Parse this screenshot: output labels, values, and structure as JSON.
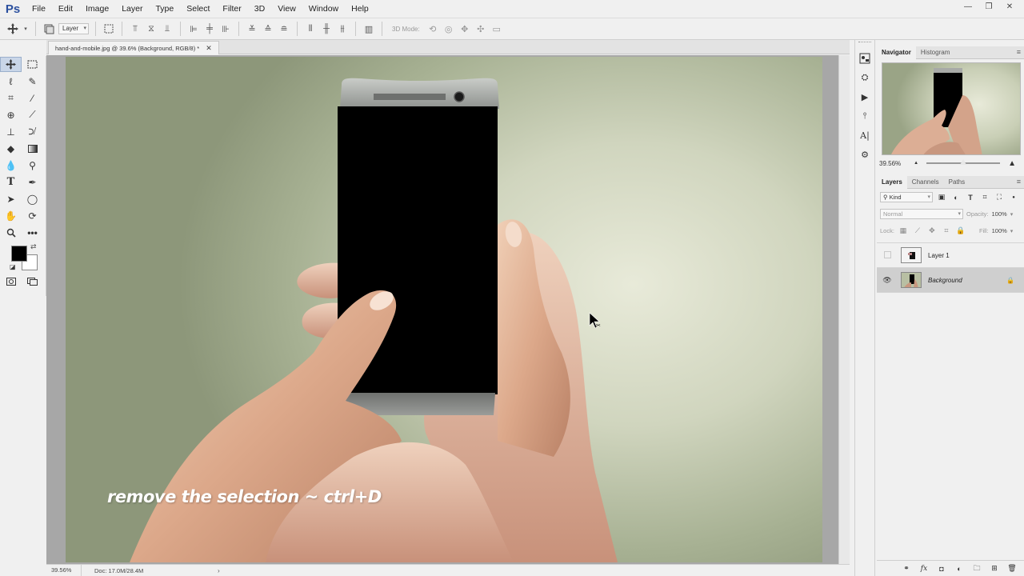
{
  "app": {
    "logo": "Ps"
  },
  "menu": [
    "File",
    "Edit",
    "Image",
    "Layer",
    "Type",
    "Select",
    "Filter",
    "3D",
    "View",
    "Window",
    "Help"
  ],
  "window_controls": [
    "—",
    "❐",
    "✕"
  ],
  "options_bar": {
    "auto_select_value": "Layer",
    "mode_3d_label": "3D Mode:"
  },
  "document": {
    "tab_title": "hand-and-mobile.jpg @ 39.6% (Background, RGB/8) *",
    "subtitle": "remove the selection ~ ctrl+D"
  },
  "status": {
    "zoom": "39.56%",
    "doc": "Doc: 17.0M/28.4M",
    "arrow": "›"
  },
  "colors": {
    "foreground": "#000000",
    "background": "#ffffff",
    "accent": "#2a4f9e"
  },
  "navigator": {
    "tabs": [
      "Navigator",
      "Histogram"
    ],
    "zoom": "39.56%",
    "zoom_slider_level": 0.5
  },
  "layers": {
    "tabs": [
      "Layers",
      "Channels",
      "Paths"
    ],
    "filter_kind": "Kind",
    "blend_mode": "Normal",
    "opacity_label": "Opacity:",
    "opacity_value": "100%",
    "lock_label": "Lock:",
    "fill_label": "Fill:",
    "fill_value": "100%",
    "items": [
      {
        "name": "Layer 1",
        "visible": false,
        "locked": false,
        "selected": false
      },
      {
        "name": "Background",
        "visible": true,
        "locked": true,
        "selected": true
      }
    ]
  },
  "icons": {
    "move": "move-icon",
    "marquee": "marquee-icon",
    "lasso": "lasso-icon",
    "quick-select": "quick-select-icon",
    "crop": "crop-icon",
    "eyedropper": "eyedropper-icon",
    "heal": "healing-brush-icon",
    "brush": "brush-icon",
    "stamp": "clone-stamp-icon",
    "history": "history-brush-icon",
    "eraser": "eraser-icon",
    "gradient": "gradient-icon",
    "blur": "blur-icon",
    "dodge": "dodge-icon",
    "type": "type-icon",
    "pen": "pen-icon",
    "path-select": "path-selection-icon",
    "shape": "ellipse-icon",
    "hand": "hand-icon",
    "rotate": "rotate-view-icon",
    "zoom": "zoom-icon",
    "more": "more-tools-icon"
  }
}
